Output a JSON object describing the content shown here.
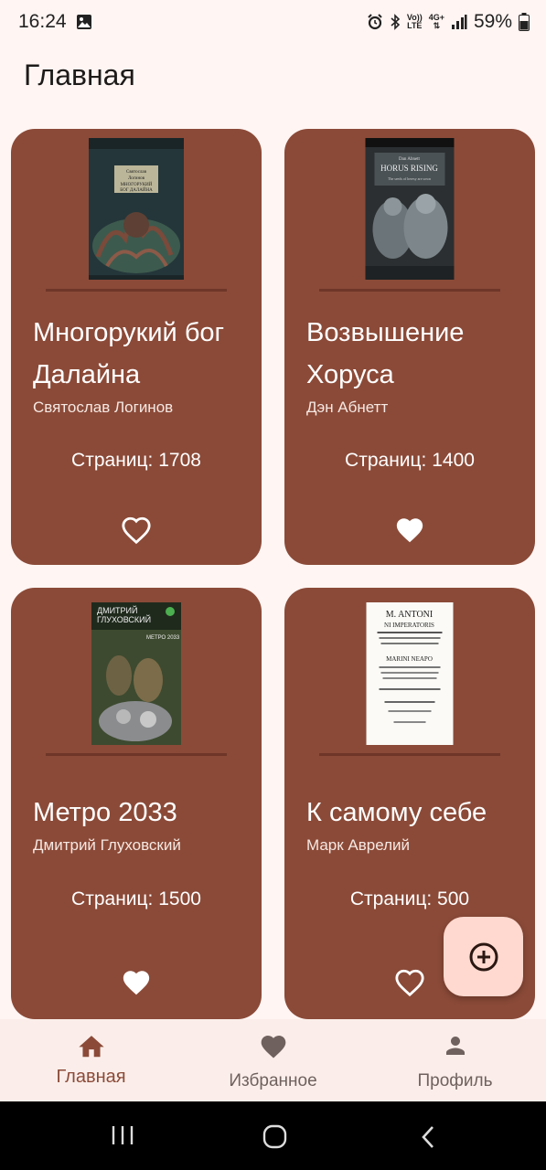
{
  "status_bar": {
    "time": "16:24",
    "battery_percent": "59%",
    "network_label_1": "Vo)) LTE",
    "network_label_2": "4G+"
  },
  "header": {
    "title": "Главная"
  },
  "books": [
    {
      "title": "Многорукий бог Далайна",
      "author": "Святослав Логинов",
      "pages": "Страниц: 1708",
      "favorite": false,
      "cover_text": [
        "Святослав",
        "Логинов",
        "МНОГОРУКИЙ",
        "БОГ ДАЛАЙНА"
      ]
    },
    {
      "title": "Возвышение Хоруса",
      "author": "Дэн Абнетт",
      "pages": "Страниц: 1400",
      "favorite": true,
      "cover_text": [
        "Dan Abnett",
        "HORUS RISING",
        "The seeds of heresy are sown"
      ]
    },
    {
      "title": "Метро 2033",
      "author": "Дмитрий Глуховский",
      "pages": "Страниц: 1500",
      "favorite": true,
      "cover_text": [
        "ДМИТРИЙ",
        "ГЛУХОВСКИЙ",
        "МЕТРО 2033"
      ]
    },
    {
      "title": "К самому себе",
      "author": "Марк Аврелий",
      "pages": "Страниц: 500",
      "favorite": false,
      "cover_text": [
        "M. ANTONI",
        "NI IMPERATORIS",
        "MARINI NEAPO"
      ]
    }
  ],
  "bottom_nav": [
    {
      "label": "Главная",
      "icon": "home-icon",
      "active": true
    },
    {
      "label": "Избранное",
      "icon": "heart-icon",
      "active": false
    },
    {
      "label": "Профиль",
      "icon": "person-icon",
      "active": false
    }
  ],
  "colors": {
    "background": "#fff5f3",
    "card": "#8b4a38",
    "fab": "#ffd9cf",
    "accent": "#8b4a38"
  }
}
